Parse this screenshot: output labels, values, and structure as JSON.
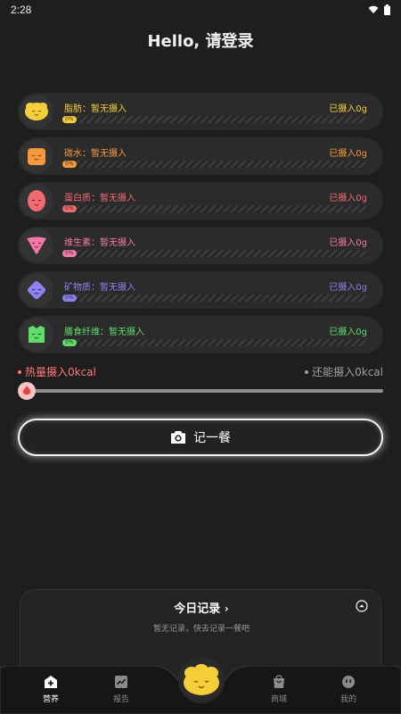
{
  "status": {
    "time": "2:28"
  },
  "header": {
    "title": "Hello, 请登录"
  },
  "nutrients": [
    {
      "name": "脂肪：暂无摄入",
      "intake": "已摄入0g",
      "percent_label": "0%",
      "color": "#f5cf3a",
      "icon": "fat-face-icon"
    },
    {
      "name": "碳水：暂无摄入",
      "intake": "已摄入0g",
      "percent_label": "0%",
      "color": "#f59a3c",
      "icon": "carb-face-icon"
    },
    {
      "name": "蛋白质：暂无摄入",
      "intake": "已摄入0g",
      "percent_label": "0%",
      "color": "#f06a72",
      "icon": "protein-face-icon"
    },
    {
      "name": "维生素：暂无摄入",
      "intake": "已摄入0g",
      "percent_label": "0%",
      "color": "#f37aa8",
      "icon": "vitamin-face-icon"
    },
    {
      "name": "矿物质：暂无摄入",
      "intake": "已摄入0g",
      "percent_label": "0%",
      "color": "#8c82f0",
      "icon": "mineral-face-icon"
    },
    {
      "name": "膳食纤维：暂无摄入",
      "intake": "已摄入0g",
      "percent_label": "0%",
      "color": "#5fdc6a",
      "icon": "fiber-face-icon"
    }
  ],
  "calories": {
    "intake_label": "热量摄入0kcal",
    "remaining_label": "还能摄入0kcal",
    "progress": 0,
    "intake_color": "#ff7878"
  },
  "actions": {
    "record_meal": "记一餐"
  },
  "today": {
    "title": "今日记录",
    "empty_text": "暂无记录，快去记录一餐吧"
  },
  "tabs": [
    {
      "label": "营养",
      "icon": "nutrition-plus-icon",
      "active": true
    },
    {
      "label": "报告",
      "icon": "report-chart-icon",
      "active": false
    },
    {
      "label": "商城",
      "icon": "shop-bag-icon",
      "active": false
    },
    {
      "label": "我的",
      "icon": "profile-face-icon",
      "active": false
    }
  ]
}
